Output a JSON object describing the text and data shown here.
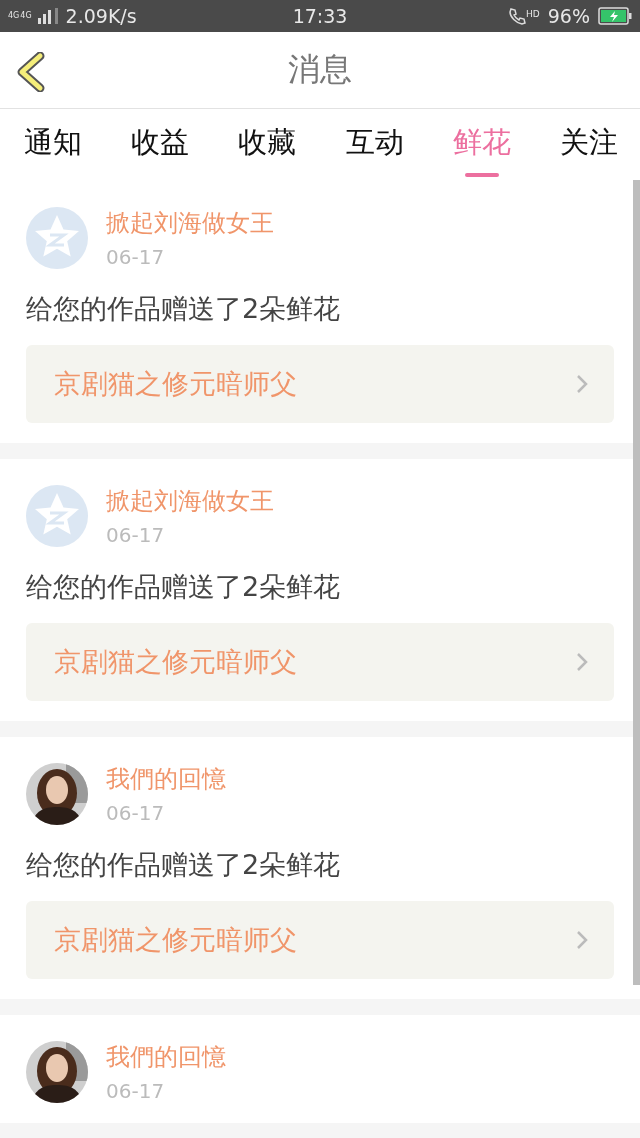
{
  "status_bar": {
    "networks": [
      "4G",
      "4G"
    ],
    "speed": "2.09K/s",
    "time": "17:33",
    "call_label": "HD",
    "battery": "96%",
    "charging": true
  },
  "header": {
    "title": "消息"
  },
  "tabs": [
    {
      "label": "通知",
      "selected": false
    },
    {
      "label": "收益",
      "selected": false
    },
    {
      "label": "收藏",
      "selected": false
    },
    {
      "label": "互动",
      "selected": false
    },
    {
      "label": "鲜花",
      "selected": true
    },
    {
      "label": "关注",
      "selected": false
    }
  ],
  "messages": [
    {
      "kind": "default",
      "name": "掀起刘海做女王",
      "date": "06-17",
      "message": "给您的作品赠送了2朵鲜花",
      "work": "京剧猫之修元暗师父"
    },
    {
      "kind": "default",
      "name": "掀起刘海做女王",
      "date": "06-17",
      "message": "给您的作品赠送了2朵鲜花",
      "work": "京剧猫之修元暗师父"
    },
    {
      "kind": "picture",
      "name": "我們的回憶",
      "date": "06-17",
      "message": "给您的作品赠送了2朵鲜花",
      "work": "京剧猫之修元暗师父"
    },
    {
      "kind": "picture",
      "name": "我們的回憶",
      "date": "06-17"
    }
  ]
}
